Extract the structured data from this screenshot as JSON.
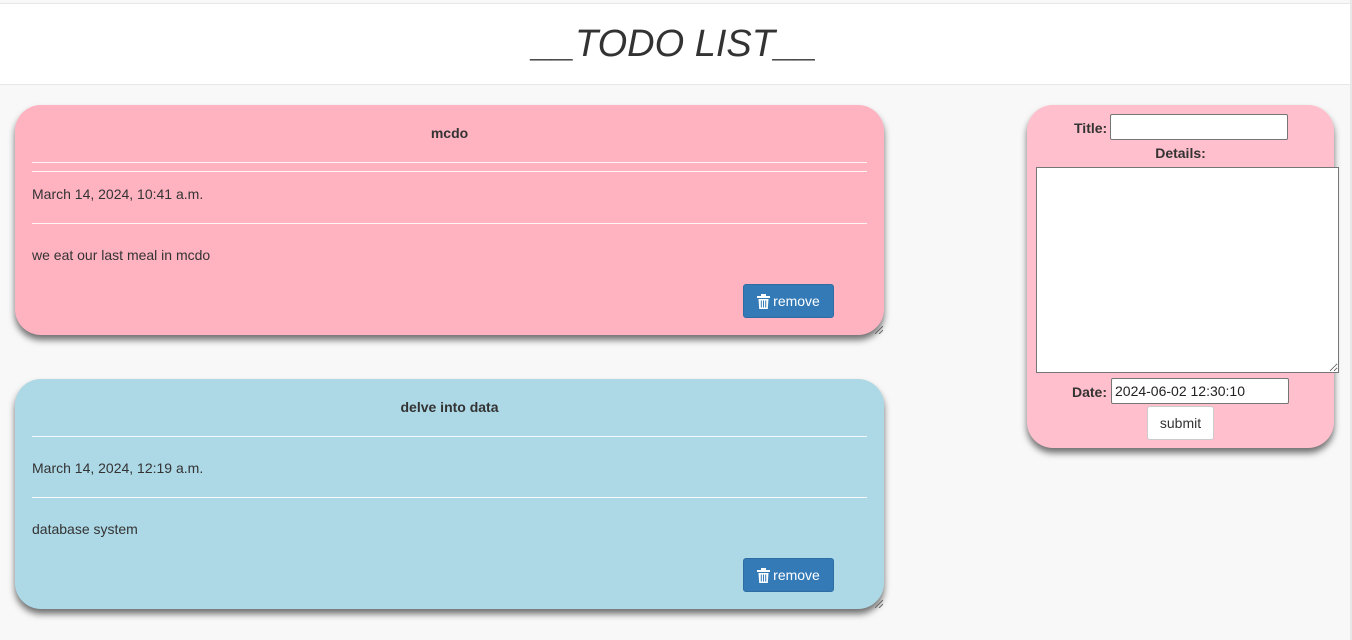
{
  "header": {
    "title": "__TODO LIST__"
  },
  "todos": [
    {
      "title": "mcdo",
      "date": "March 14, 2024, 10:41 a.m.",
      "details": "we eat our last meal in mcdo",
      "remove_label": "remove",
      "color": "#ffb3c1"
    },
    {
      "title": "delve into data",
      "date": "March 14, 2024, 12:19 a.m.",
      "details": "database system",
      "remove_label": "remove",
      "color": "#add8e6"
    }
  ],
  "form": {
    "title_label": "Title:",
    "title_value": "",
    "details_label": "Details:",
    "details_value": "",
    "date_label": "Date:",
    "date_value": "2024-06-02 12:30:10",
    "submit_label": "submit",
    "color": "#ffbfcc"
  },
  "colors": {
    "button_primary": "#337ab7"
  },
  "icons": {
    "remove": "trash-icon"
  }
}
